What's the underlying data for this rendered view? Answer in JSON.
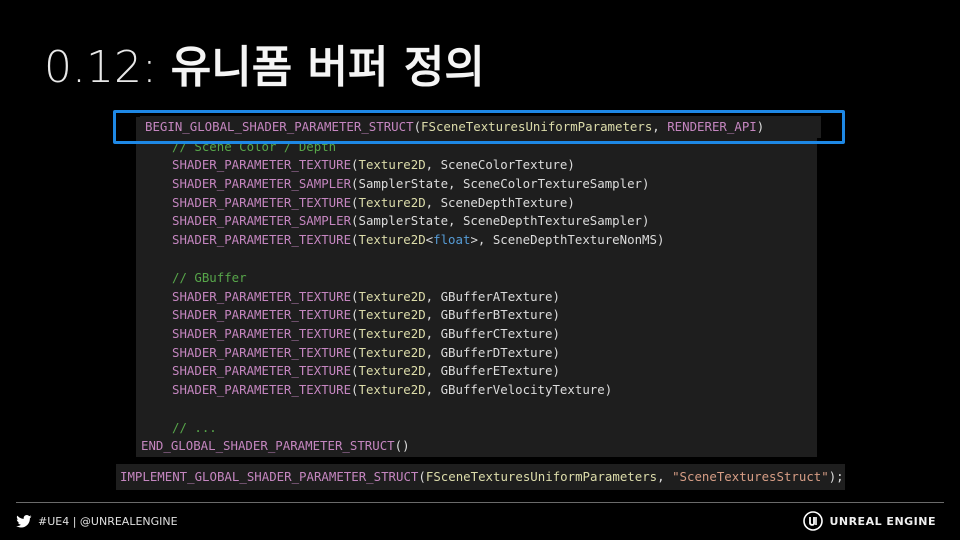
{
  "slide": {
    "title_number": "0.12:",
    "title_text": "유니폼 버퍼 정의"
  },
  "code": {
    "begin_macro": "BEGIN_GLOBAL_SHADER_PARAMETER_STRUCT",
    "begin_struct": "FSceneTexturesUniformParameters",
    "begin_api": "RENDERER_API",
    "comment_scene": "// Scene Color / Depth",
    "comment_gbuffer": "// GBuffer",
    "comment_more": "// ...",
    "texture_macro": "SHADER_PARAMETER_TEXTURE",
    "sampler_macro": "SHADER_PARAMETER_SAMPLER",
    "texture_type": "Texture2D",
    "sampler_type": "SamplerState",
    "float_type": "float",
    "params": [
      "SceneColorTexture",
      "SceneColorTextureSampler",
      "SceneDepthTexture",
      "SceneDepthTextureSampler",
      "SceneDepthTextureNonMS",
      "GBufferATexture",
      "GBufferBTexture",
      "GBufferCTexture",
      "GBufferDTexture",
      "GBufferETexture",
      "GBufferVelocityTexture"
    ],
    "end_macro": "END_GLOBAL_SHADER_PARAMETER_STRUCT",
    "implement_macro": "IMPLEMENT_GLOBAL_SHADER_PARAMETER_STRUCT",
    "implement_struct": "FSceneTexturesUniformParameters",
    "implement_name": "\"SceneTexturesStruct\""
  },
  "footer": {
    "twitter_text": "#UE4 | @UNREALENGINE",
    "brand_text": "UNREAL ENGINE"
  },
  "icons": {
    "twitter": "twitter-icon",
    "unreal": "unreal-logo-icon"
  },
  "colors": {
    "highlight": "#1e88e5",
    "macro": "#c586c0",
    "type": "#dcdcaa",
    "comment": "#57a64a",
    "keyword": "#569cd6"
  }
}
